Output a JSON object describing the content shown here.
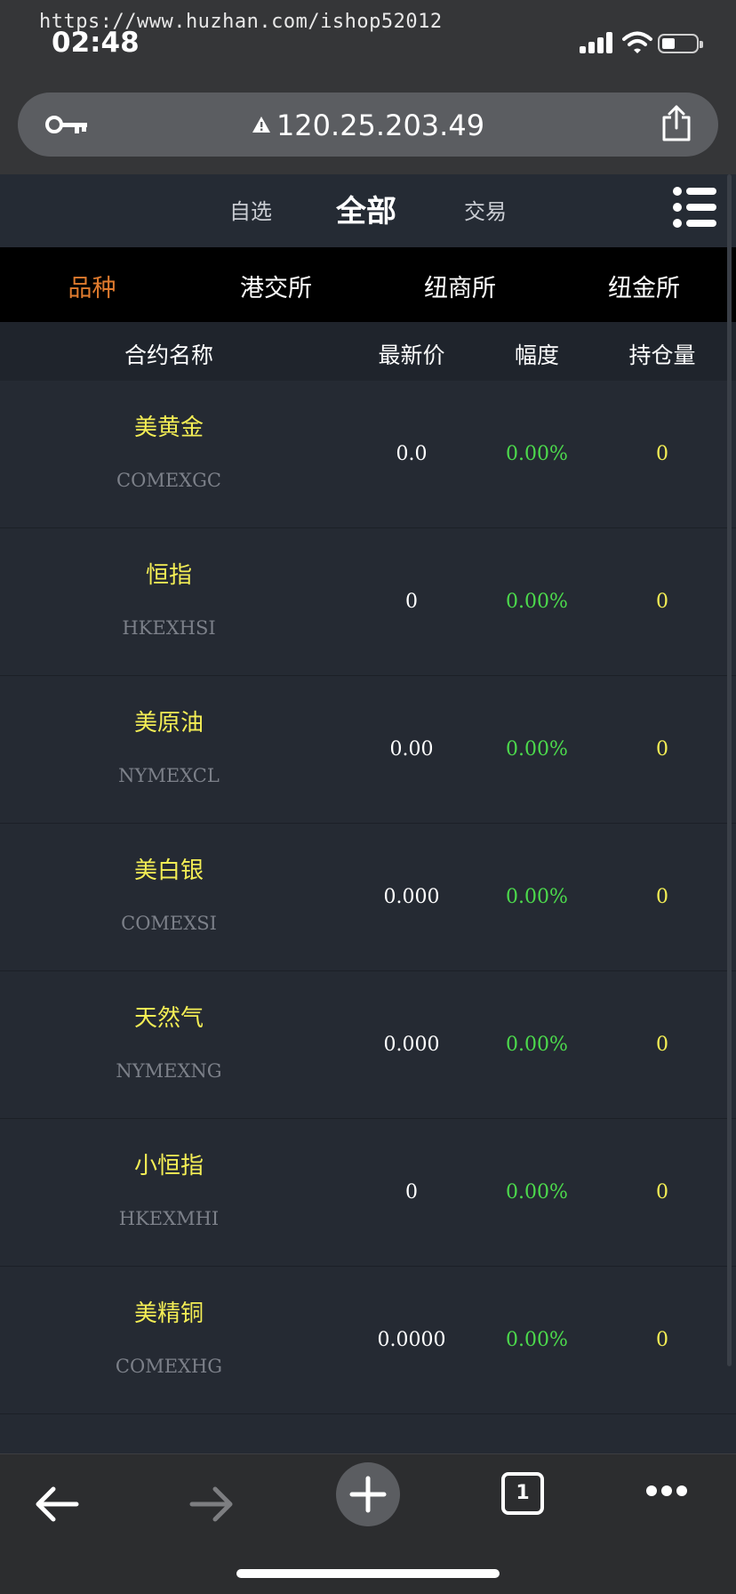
{
  "watermark": "https://www.huzhan.com/ishop52012",
  "status": {
    "time": "02:48"
  },
  "browser": {
    "url": "120.25.203.49",
    "tab_count": "1"
  },
  "app": {
    "top_tabs": [
      "自选",
      "全部",
      "交易"
    ],
    "active_top_tab": 1,
    "exchange_tabs": [
      "品种",
      "港交所",
      "纽商所",
      "纽金所"
    ],
    "active_exchange_tab": 0,
    "columns": [
      "合约名称",
      "最新价",
      "幅度",
      "持仓量"
    ],
    "rows": [
      {
        "name": "美黄金",
        "code": "COMEXGC",
        "price": "0.0",
        "change": "0.00%",
        "position": "0"
      },
      {
        "name": "恒指",
        "code": "HKEXHSI",
        "price": "0",
        "change": "0.00%",
        "position": "0"
      },
      {
        "name": "美原油",
        "code": "NYMEXCL",
        "price": "0.00",
        "change": "0.00%",
        "position": "0"
      },
      {
        "name": "美白银",
        "code": "COMEXSI",
        "price": "0.000",
        "change": "0.00%",
        "position": "0"
      },
      {
        "name": "天然气",
        "code": "NYMEXNG",
        "price": "0.000",
        "change": "0.00%",
        "position": "0"
      },
      {
        "name": "小恒指",
        "code": "HKEXMHI",
        "price": "0",
        "change": "0.00%",
        "position": "0"
      },
      {
        "name": "美精铜",
        "code": "COMEXHG",
        "price": "0.0000",
        "change": "0.00%",
        "position": "0"
      }
    ]
  },
  "colors": {
    "accent_orange": "#e07b2e",
    "name_yellow": "#f4ee55",
    "change_green": "#4cd94c",
    "header_bg": "#252b34"
  },
  "icons": [
    "key-icon",
    "warning-icon",
    "share-icon",
    "menu-icon",
    "back-arrow-icon",
    "forward-arrow-icon",
    "new-tab-plus-icon",
    "tabs-icon",
    "more-dots-icon"
  ]
}
